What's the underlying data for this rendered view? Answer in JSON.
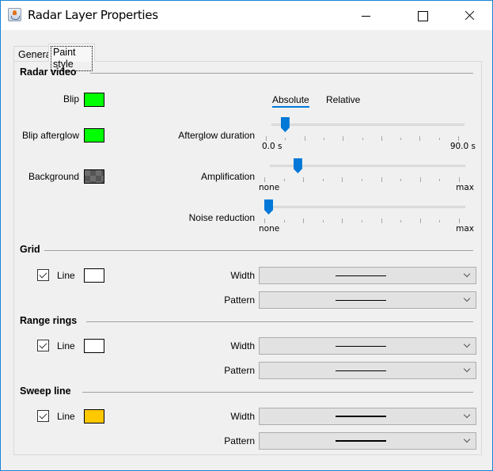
{
  "window": {
    "title": "Radar Layer Properties",
    "icon": "java-cup-icon",
    "controls": [
      "minimize",
      "maximize",
      "close"
    ]
  },
  "tabs": [
    {
      "label": "General",
      "selected": false
    },
    {
      "label": "Paint style",
      "selected": true
    }
  ],
  "radar_video": {
    "title": "Radar video",
    "blip": {
      "label": "Blip",
      "color": "#00ff00"
    },
    "blip_afterglow": {
      "label": "Blip afterglow",
      "color": "#00ff00"
    },
    "background": {
      "label": "Background",
      "color": "transparent-checker"
    },
    "mode_tabs": [
      {
        "label": "Absolute",
        "selected": true
      },
      {
        "label": "Relative",
        "selected": false
      }
    ],
    "afterglow_duration": {
      "label": "Afterglow duration",
      "min_label": "0.0 s",
      "max_label": "90.0 s",
      "min": 0,
      "max": 90,
      "value": 7,
      "unit": "s"
    },
    "amplification": {
      "label": "Amplification",
      "min_label": "none",
      "max_label": "max",
      "fraction": 0.15
    },
    "noise_reduction": {
      "label": "Noise reduction",
      "min_label": "none",
      "max_label": "max",
      "fraction": 0.0
    }
  },
  "grid": {
    "title": "Grid",
    "line": {
      "label": "Line",
      "checked": true,
      "color": "#ffffff"
    },
    "width": {
      "label": "Width",
      "value": "thin-line"
    },
    "pattern": {
      "label": "Pattern",
      "value": "solid"
    }
  },
  "range_rings": {
    "title": "Range rings",
    "line": {
      "label": "Line",
      "checked": true,
      "color": "#ffffff"
    },
    "width": {
      "label": "Width",
      "value": "thin-line"
    },
    "pattern": {
      "label": "Pattern",
      "value": "solid"
    }
  },
  "sweep_line": {
    "title": "Sweep line",
    "line": {
      "label": "Line",
      "checked": true,
      "color": "#ffc800"
    },
    "width": {
      "label": "Width",
      "value": "thick-line"
    },
    "pattern": {
      "label": "Pattern",
      "value": "solid"
    }
  }
}
